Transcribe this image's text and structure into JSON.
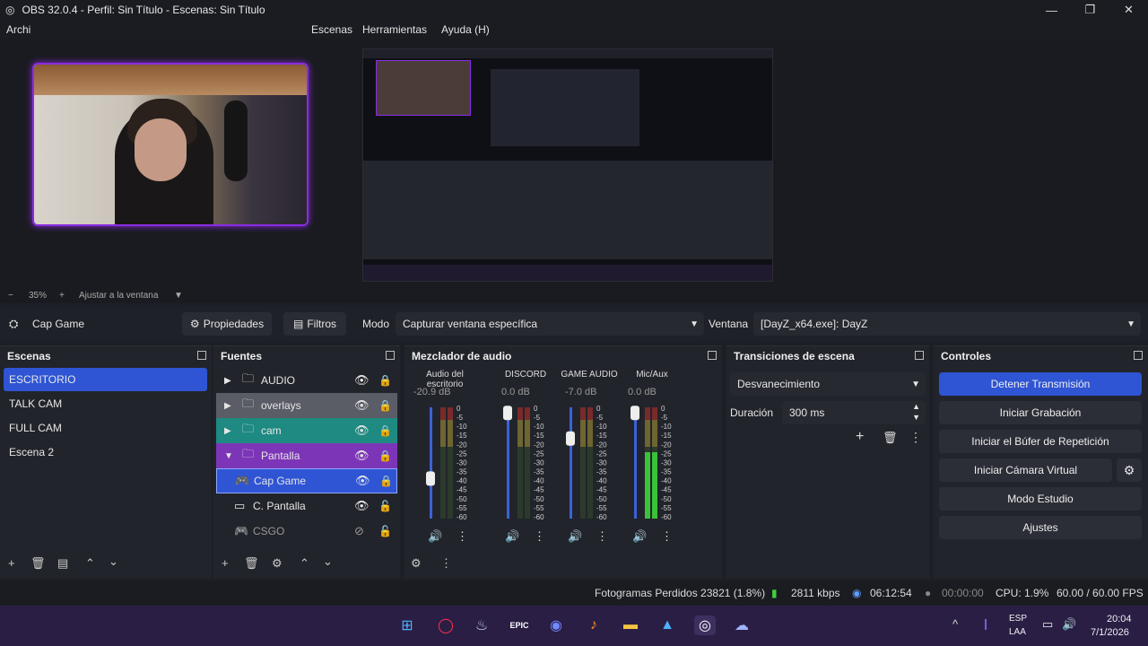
{
  "window": {
    "title": "OBS 32.0.4 - Perfil: Sin Título - Escenas: Sin Título",
    "min": "—",
    "max": "❐",
    "close": "✕"
  },
  "menu": {
    "archivo": "Archi",
    "escenas": "Escenas",
    "herramientas": "Herramientas",
    "ayuda": "Ayuda (H)"
  },
  "zoom": {
    "minus": "−",
    "level": "35%",
    "plus": "+",
    "fit": "Ajustar a la ventana"
  },
  "source_bar": {
    "name": "Cap Game",
    "properties": "Propiedades",
    "filters": "Filtros",
    "mode_label": "Modo",
    "mode_value": "Capturar ventana específica",
    "window_label": "Ventana",
    "window_value": "[DayZ_x64.exe]: DayZ"
  },
  "scenes": {
    "title": "Escenas",
    "items": [
      "ESCRITORIO",
      "TALK CAM",
      "FULL CAM",
      "Escena 2"
    ]
  },
  "sources": {
    "title": "Fuentes",
    "items": [
      "AUDIO",
      "overlays",
      "cam",
      "Pantalla",
      "Cap Game",
      "C. Pantalla",
      "CSGO"
    ]
  },
  "mixer": {
    "title": "Mezclador de audio",
    "channels": [
      {
        "name": "Audio del escritorio",
        "db": "-20.9 dB",
        "level": 0.36
      },
      {
        "name": "DISCORD",
        "db": "0.0 dB",
        "level": 0.95
      },
      {
        "name": "GAME AUDIO",
        "db": "-7.0 dB",
        "level": 0.72
      },
      {
        "name": "Mic/Aux",
        "db": "0.0 dB",
        "level": 0.95
      }
    ],
    "scale": [
      "0",
      "-5",
      "-10",
      "-15",
      "-20",
      "-25",
      "-30",
      "-35",
      "-40",
      "-45",
      "-50",
      "-55",
      "-60"
    ]
  },
  "transitions": {
    "title": "Transiciones de escena",
    "type": "Desvanecimiento",
    "duration_label": "Duración",
    "duration_value": "300 ms"
  },
  "controls": {
    "title": "Controles",
    "stop_stream": "Detener Transmisión",
    "start_record": "Iniciar Grabación",
    "replay_buffer": "Iniciar el Búfer de Repetición",
    "virtual_cam": "Iniciar Cámara Virtual",
    "studio_mode": "Modo Estudio",
    "settings": "Ajustes"
  },
  "status": {
    "dropped": "Fotogramas Perdidos 23821 (1.8%)",
    "bitrate": "2811 kbps",
    "stream_time": "06:12:54",
    "record_time": "00:00:00",
    "cpu": "CPU: 1.9%",
    "fps": "60.00 / 60.00 FPS"
  },
  "taskbar": {
    "lang1": "ESP",
    "lang2": "LAA",
    "time": "20:04",
    "date": "7/1/2026",
    "caret": "^"
  },
  "colors": {
    "accent": "#2f55d4",
    "purple": "#7d35b8",
    "teal": "#1e8a82",
    "gray_sel": "#5a5c66"
  }
}
